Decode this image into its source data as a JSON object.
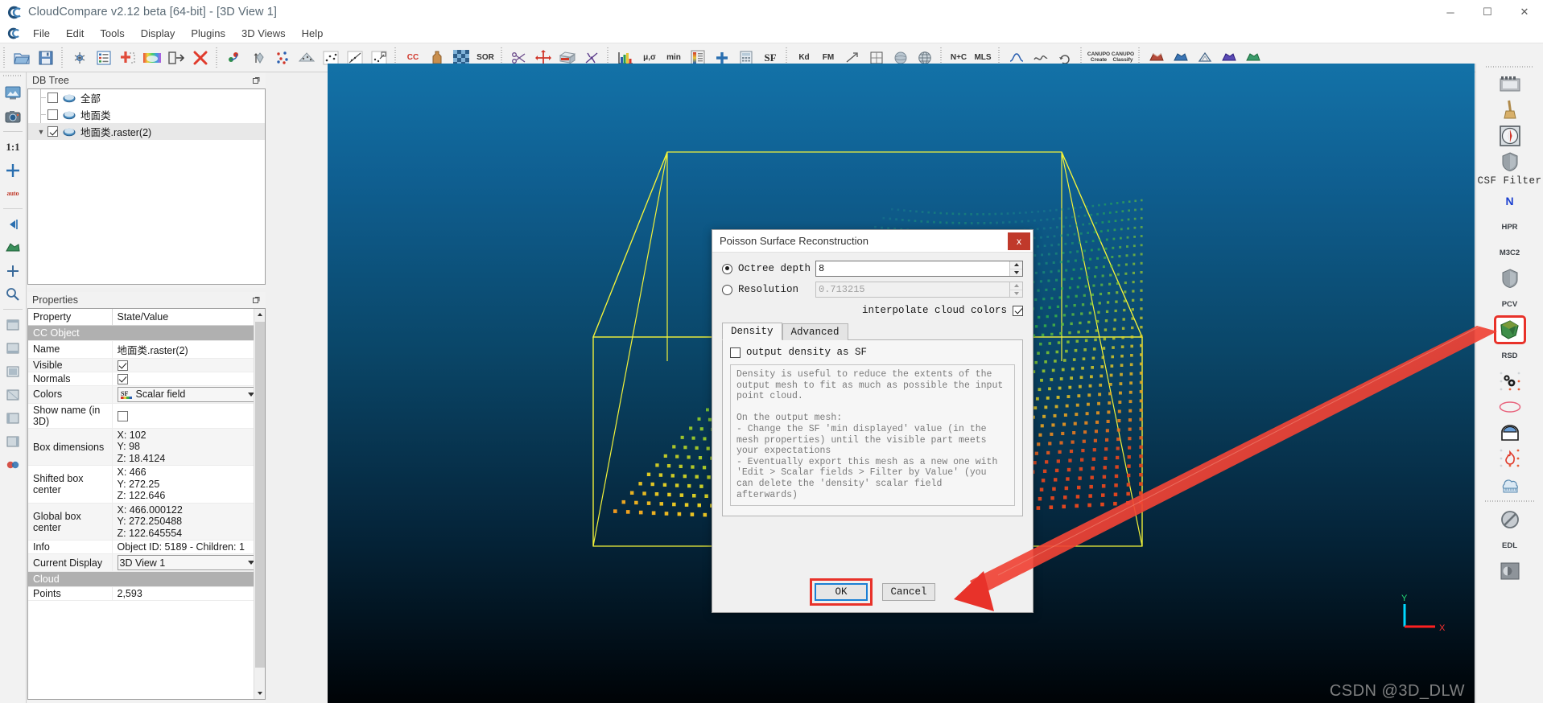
{
  "window": {
    "title": "CloudCompare v2.12 beta [64-bit] - [3D View 1]",
    "logo": "CC",
    "buttons": {
      "minimize": "─",
      "maximize": "☐",
      "close": "✕"
    }
  },
  "menu": {
    "items": [
      {
        "label": "File",
        "mnemonic": "F"
      },
      {
        "label": "Edit",
        "mnemonic": "E"
      },
      {
        "label": "Tools",
        "mnemonic": "T"
      },
      {
        "label": "Display",
        "mnemonic": "D"
      },
      {
        "label": "Plugins",
        "mnemonic": "P"
      },
      {
        "label": "3D Views",
        "mnemonic": "V"
      },
      {
        "label": "Help",
        "mnemonic": "H"
      }
    ]
  },
  "toolbar": {
    "groups": [
      {
        "icons": [
          {
            "name": "open-file-icon",
            "glyph": "📂"
          },
          {
            "name": "save-icon",
            "glyph": "💾"
          }
        ]
      },
      {
        "icons": [
          {
            "name": "clone-icon",
            "glyph": "✦"
          },
          {
            "name": "properties-list-icon",
            "glyph": "☰"
          },
          {
            "name": "merge-icon",
            "glyph": "✚"
          },
          {
            "name": "colorize-icon",
            "glyph": "◭"
          },
          {
            "name": "apply-transformation-icon",
            "glyph": "⇥"
          },
          {
            "name": "delete-icon",
            "glyph": "✕"
          }
        ]
      },
      {
        "icons": [
          {
            "name": "point-picking-icon",
            "glyph": "∴"
          },
          {
            "name": "point-list-picking-icon",
            "glyph": "↑"
          },
          {
            "name": "point-pair-align-icon",
            "glyph": "⁙"
          },
          {
            "name": "segment-icon",
            "glyph": "◧"
          },
          {
            "name": "trace-polyline-icon",
            "glyph": "↗"
          },
          {
            "name": "scissors-crop-icon",
            "glyph": "◸"
          },
          {
            "name": "interactive-seg-icon",
            "glyph": "◫"
          }
        ]
      },
      {
        "icons": [
          {
            "name": "cc-registration-icon",
            "label": "CC"
          },
          {
            "name": "clay-icon",
            "glyph": "⚒"
          },
          {
            "name": "checkerboard-icon",
            "glyph": "▦"
          },
          {
            "name": "sor-filter-icon",
            "label": "SOR"
          }
        ]
      },
      {
        "icons": [
          {
            "name": "cut-scissors-icon",
            "glyph": "✂"
          },
          {
            "name": "translate-rotate-icon",
            "glyph": "✛"
          },
          {
            "name": "cross-section-icon",
            "glyph": "◪"
          },
          {
            "name": "fit-plane-icon",
            "glyph": "✗"
          }
        ]
      },
      {
        "icons": [
          {
            "name": "histogram-icon",
            "glyph": "📊"
          },
          {
            "name": "stats-gaussian-icon",
            "label": "μ,σ"
          },
          {
            "name": "min-max-icon",
            "label": "min"
          },
          {
            "name": "scalar-field-palette-icon",
            "glyph": "▥"
          },
          {
            "name": "add-scalar-field-icon",
            "glyph": "✚"
          },
          {
            "name": "compute-icon",
            "glyph": "▤"
          },
          {
            "name": "sf-icon",
            "label": "SF"
          }
        ]
      },
      {
        "icons": [
          {
            "name": "kdtree-icon",
            "label": "Kd"
          },
          {
            "name": "fit-model-icon",
            "label": "FM"
          },
          {
            "name": "normals-compute-icon",
            "glyph": "↗"
          },
          {
            "name": "octree-icon",
            "glyph": "▣"
          },
          {
            "name": "sphere-icon",
            "glyph": "●"
          },
          {
            "name": "globe-icon",
            "glyph": "◌"
          }
        ]
      },
      {
        "icons": [
          {
            "name": "normals-compute-nc-icon",
            "label": "N+C"
          },
          {
            "name": "mls-icon",
            "label": "MLS"
          }
        ]
      },
      {
        "icons": [
          {
            "name": "curve-icon",
            "glyph": "∿"
          },
          {
            "name": "smooth-icon",
            "glyph": "∼"
          },
          {
            "name": "resample-icon",
            "glyph": "↻"
          }
        ]
      },
      {
        "icons": [
          {
            "name": "canupo-create-icon",
            "label": "CANUPO\nCreate"
          },
          {
            "name": "canupo-classify-icon",
            "label": "CANUPO\nClassify"
          }
        ]
      },
      {
        "icons": [
          {
            "name": "mesh-tool-1-icon",
            "glyph": "◬"
          },
          {
            "name": "mesh-tool-2-icon",
            "glyph": "◬"
          },
          {
            "name": "mesh-tool-3-icon",
            "glyph": "△"
          },
          {
            "name": "mesh-tool-4-icon",
            "glyph": "◬"
          },
          {
            "name": "mesh-tool-5-icon",
            "glyph": "◬"
          }
        ]
      }
    ]
  },
  "left_toolbar": {
    "icons": [
      {
        "name": "set-view-icon",
        "glyph": "🖼"
      },
      {
        "name": "snapshot-icon",
        "glyph": "📷"
      },
      {
        "name": "zoom-1-1-icon",
        "label": "1:1"
      },
      {
        "name": "global-zoom-icon",
        "glyph": "✚"
      },
      {
        "name": "auto-zoom-icon",
        "label": "auto"
      },
      {
        "name": "pick-rotation-center-icon",
        "glyph": "◀"
      },
      {
        "name": "toggle-colors-icon",
        "glyph": "◩"
      },
      {
        "name": "point-size-plus-icon",
        "glyph": "✚"
      },
      {
        "name": "zoom-tool-icon",
        "glyph": "🔍"
      },
      {
        "name": "front-view-icon",
        "glyph": "□"
      },
      {
        "name": "bottom-view-icon",
        "glyph": "□"
      },
      {
        "name": "top-view-icon",
        "glyph": "□"
      },
      {
        "name": "back-view-icon",
        "glyph": "□"
      },
      {
        "name": "left-view-icon",
        "glyph": "□"
      },
      {
        "name": "right-view-icon",
        "glyph": "□"
      },
      {
        "name": "stereo-icon",
        "glyph": "◉"
      }
    ]
  },
  "right_toolbar": {
    "icons": [
      {
        "name": "animation-icon",
        "glyph": "🎬"
      },
      {
        "name": "broom-icon",
        "glyph": "🧹"
      },
      {
        "name": "compass-icon",
        "glyph": "🧭"
      },
      {
        "name": "csf-filter-icon",
        "glyph": "◆"
      }
    ],
    "csf_label": "CSF Filter",
    "icons2": [
      {
        "name": "normals-n-icon",
        "label": "N"
      },
      {
        "name": "hpr-icon",
        "label": "HPR"
      },
      {
        "name": "m3c2-icon",
        "label": "M3C2"
      },
      {
        "name": "shield-icon",
        "glyph": "◆"
      },
      {
        "name": "pcv-icon",
        "label": "PCV"
      },
      {
        "name": "poisson-recon-icon",
        "glyph": "⬟",
        "highlighted": true
      },
      {
        "name": "rsd-icon",
        "label": "RSD"
      },
      {
        "name": "gears-icon",
        "glyph": "⚙"
      },
      {
        "name": "ellipse-icon",
        "glyph": "⬭"
      },
      {
        "name": "tunnel-icon",
        "glyph": "∩"
      },
      {
        "name": "flame-icon",
        "glyph": "🔥"
      },
      {
        "name": "cloud-ruler-icon",
        "glyph": "☁"
      }
    ],
    "icons3": [
      {
        "name": "no-filter-icon",
        "glyph": "⊘"
      },
      {
        "name": "edl-shader-icon",
        "label": "EDL"
      },
      {
        "name": "ssao-shader-icon",
        "glyph": "◑"
      }
    ]
  },
  "db_tree": {
    "title": "DB Tree",
    "items": [
      {
        "label": "全部",
        "checked": false,
        "expander": "",
        "indent": true
      },
      {
        "label": "地面类",
        "checked": false,
        "expander": "",
        "indent": true
      },
      {
        "label": "地面类.raster(2)",
        "checked": true,
        "expander": "▼",
        "indent": false,
        "selected": true
      }
    ]
  },
  "properties": {
    "title": "Properties",
    "headers": [
      "Property",
      "State/Value"
    ],
    "rows": [
      {
        "type": "section",
        "label": "CC Object"
      },
      {
        "type": "text",
        "key": "Name",
        "value": "地面类.raster(2)"
      },
      {
        "type": "checkbox",
        "key": "Visible",
        "checked": true
      },
      {
        "type": "checkbox",
        "key": "Normals",
        "checked": true
      },
      {
        "type": "combo",
        "key": "Colors",
        "value": "Scalar field"
      },
      {
        "type": "checkbox",
        "key": "Show name (in 3D)",
        "checked": false
      },
      {
        "type": "multi",
        "key": "Box dimensions",
        "lines": [
          "X: 102",
          "Y: 98",
          "Z: 18.4124"
        ]
      },
      {
        "type": "multi",
        "key": "Shifted box center",
        "lines": [
          "X: 466",
          "Y: 272.25",
          "Z: 122.646"
        ]
      },
      {
        "type": "multi",
        "key": "Global box center",
        "lines": [
          "X: 466.000122",
          "Y: 272.250488",
          "Z: 122.645554"
        ]
      },
      {
        "type": "text",
        "key": "Info",
        "value": "Object ID: 5189 - Children: 1"
      },
      {
        "type": "combo2",
        "key": "Current Display",
        "value": "3D View 1"
      },
      {
        "type": "section",
        "label": "Cloud"
      },
      {
        "type": "text",
        "key": "Points",
        "value": "2,593"
      }
    ]
  },
  "dialog": {
    "title": "Poisson Surface Reconstruction",
    "close_label": "x",
    "octree_depth": {
      "label": "Octree depth",
      "value": "8",
      "selected": true
    },
    "resolution": {
      "label": "Resolution",
      "value": "0.713215",
      "selected": false,
      "disabled": true
    },
    "interpolate": {
      "label": "interpolate cloud colors",
      "checked": true
    },
    "tabs": [
      {
        "label": "Density",
        "active": true
      },
      {
        "label": "Advanced",
        "active": false
      }
    ],
    "output_density": {
      "label": "output density as SF",
      "checked": false
    },
    "description": "Density is useful to reduce the extents of the output mesh to fit as much as possible the input point cloud.\n\nOn the output mesh:\n- Change the SF 'min displayed' value (in the mesh properties) until the visible part meets your expectations\n- Eventually export this mesh as a new one with 'Edit > Scalar fields > Filter by Value' (you can delete the 'density' scalar field afterwards)",
    "buttons": {
      "ok": "OK",
      "cancel": "Cancel"
    }
  },
  "viewport": {
    "axis": {
      "x": "X",
      "y": "Y"
    },
    "watermark": "CSDN @3D_DLW",
    "colors": {
      "bg_top": "#1372a8",
      "bg_bottom": "#000306",
      "bbox_line": "#f2f23a",
      "accent_red": "#e8322a"
    }
  }
}
